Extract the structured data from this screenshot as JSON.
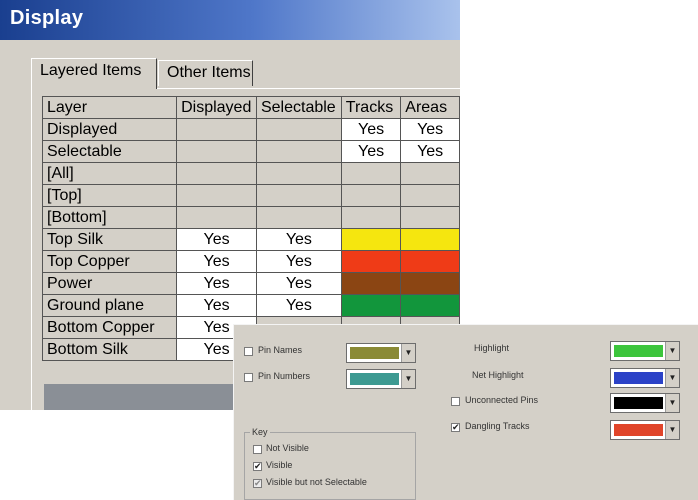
{
  "window": {
    "title": "Display"
  },
  "tabs": [
    {
      "label": "Layered Items"
    },
    {
      "label": "Other Items"
    }
  ],
  "grid": {
    "headers": [
      "Layer",
      "Displayed",
      "Selectable",
      "Tracks",
      "Areas"
    ],
    "rows": [
      {
        "label": "Displayed",
        "cells": [
          "",
          "",
          "Yes",
          "Yes"
        ]
      },
      {
        "label": "Selectable",
        "cells": [
          "",
          "",
          "Yes",
          "Yes"
        ]
      },
      {
        "label": "[All]",
        "cells": [
          "",
          "",
          "",
          ""
        ]
      },
      {
        "label": "[Top]",
        "cells": [
          "",
          "",
          "",
          ""
        ]
      },
      {
        "label": "[Bottom]",
        "cells": [
          "",
          "",
          "",
          ""
        ]
      },
      {
        "label": "Top Silk",
        "cells": [
          "Yes",
          "Yes",
          "",
          ""
        ],
        "color": "#f5e60f"
      },
      {
        "label": "Top Copper",
        "cells": [
          "Yes",
          "Yes",
          "",
          ""
        ],
        "color": "#ef3b17"
      },
      {
        "label": "Power",
        "cells": [
          "Yes",
          "Yes",
          "",
          ""
        ],
        "color": "#8b4513"
      },
      {
        "label": "Ground plane",
        "cells": [
          "Yes",
          "Yes",
          "",
          ""
        ],
        "color": "#12963c"
      },
      {
        "label": "Bottom Copper",
        "cells": [
          "Yes",
          "",
          "",
          ""
        ]
      },
      {
        "label": "Bottom Silk",
        "cells": [
          "Yes",
          "",
          "",
          ""
        ]
      }
    ]
  },
  "options": {
    "pin_names": {
      "label": "Pin Names",
      "color": "#8a8a35"
    },
    "pin_numbers": {
      "label": "Pin Numbers",
      "color": "#3d9a92"
    },
    "highlight": {
      "label": "Highlight",
      "color": "#3cc53c"
    },
    "net_highlight": {
      "label": "Net Highlight",
      "color": "#2b42c7"
    },
    "unconnected_pins": {
      "label": "Unconnected Pins",
      "color": "#000000"
    },
    "dangling_tracks": {
      "label": "Dangling Tracks",
      "color": "#e0452a",
      "checked": true
    }
  },
  "key": {
    "title": "Key",
    "items": [
      {
        "label": "Not Visible",
        "mark": ""
      },
      {
        "label": "Visible",
        "mark": "✔"
      },
      {
        "label": "Visible but not Selectable",
        "mark": "✔"
      }
    ]
  }
}
